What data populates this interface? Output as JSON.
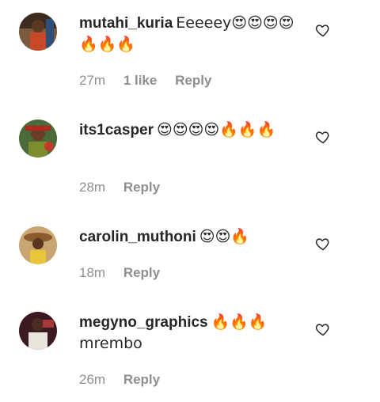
{
  "comments": [
    {
      "username": "mutahi_kuria",
      "text": "Eeeeey😍😍😍😍🔥🔥🔥",
      "time": "27m",
      "likes": "1 like",
      "reply_label": "Reply",
      "like_icon": "heart-outline-icon"
    },
    {
      "username": "its1casper",
      "text": "😍😍😍😍🔥🔥🔥",
      "time": "28m",
      "reply_label": "Reply",
      "like_icon": "heart-outline-icon"
    },
    {
      "username": "carolin_muthoni",
      "text": "😍😍🔥",
      "time": "18m",
      "reply_label": "Reply",
      "like_icon": "heart-outline-icon"
    },
    {
      "username": "megyno_graphics",
      "text": "🔥🔥🔥 mrembo",
      "time": "26m",
      "reply_label": "Reply",
      "like_icon": "heart-outline-icon"
    }
  ],
  "colors": {
    "text": "#262626",
    "meta": "#8e8e8e",
    "icon_stroke": "#262626"
  }
}
